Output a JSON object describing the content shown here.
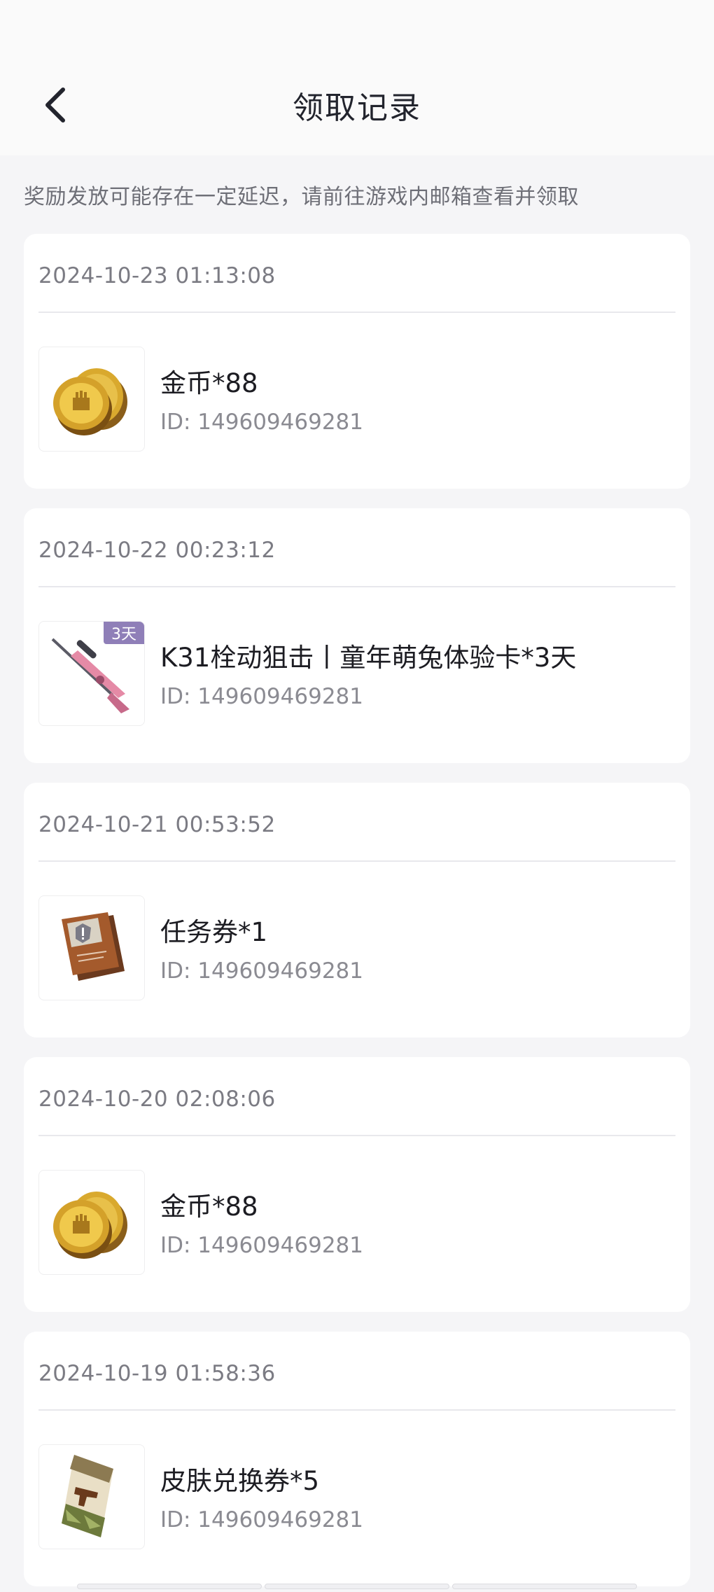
{
  "header": {
    "title": "领取记录"
  },
  "notice": "奖励发放可能存在一定延迟，请前往游戏内邮箱查看并领取",
  "records": [
    {
      "time": "2024-10-23 01:13:08",
      "name": "金币*88",
      "id": "ID: 149609469281",
      "icon": "gold-coins-icon"
    },
    {
      "time": "2024-10-22 00:23:12",
      "name": "K31栓动狙击丨童年萌兔体验卡*3天",
      "id": "ID: 149609469281",
      "icon": "sniper-rifle-icon",
      "badge": "3天"
    },
    {
      "time": "2024-10-21 00:53:52",
      "name": "任务券*1",
      "id": "ID: 149609469281",
      "icon": "mission-ticket-icon"
    },
    {
      "time": "2024-10-20 02:08:06",
      "name": "金币*88",
      "id": "ID: 149609469281",
      "icon": "gold-coins-icon"
    },
    {
      "time": "2024-10-19 01:58:36",
      "name": "皮肤兑换券*5",
      "id": "ID: 149609469281",
      "icon": "skin-voucher-icon"
    }
  ]
}
